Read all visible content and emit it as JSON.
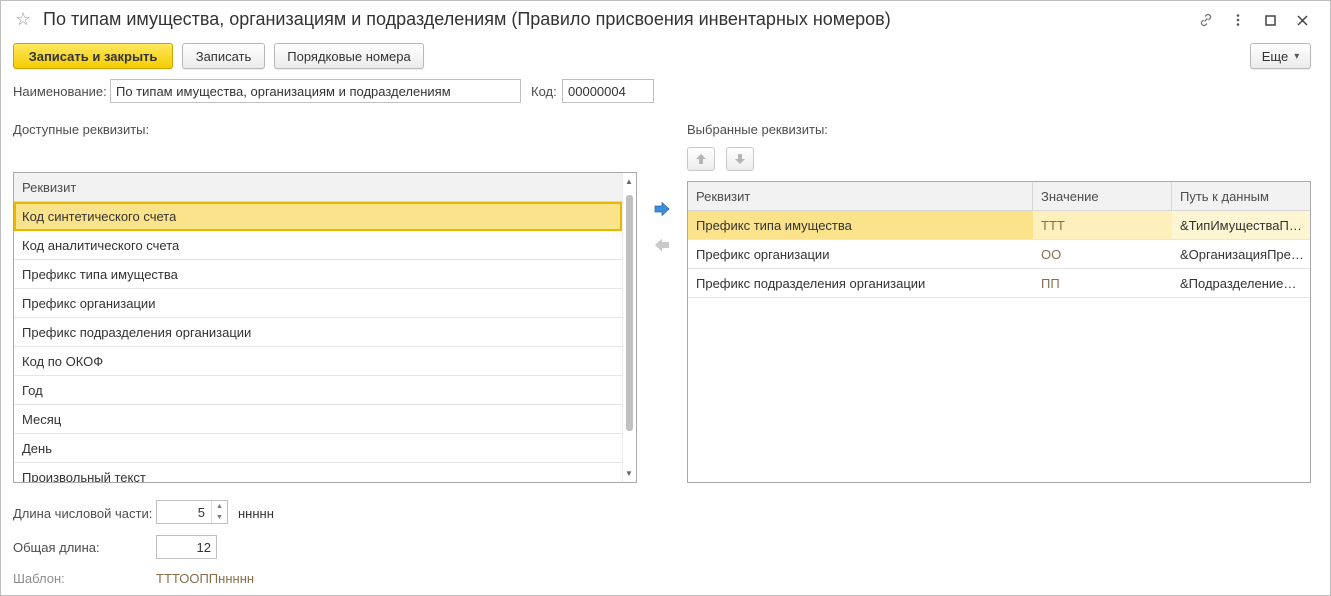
{
  "window": {
    "title": "По типам имущества, организациям и подразделениям (Правило присвоения инвентарных номеров)",
    "icons": [
      "star-icon",
      "link-icon",
      "more-vertical-icon",
      "maximize-icon",
      "close-icon"
    ]
  },
  "toolbar": {
    "save_close": "Записать и закрыть",
    "save": "Записать",
    "ordinal_numbers": "Порядковые номера",
    "more": "Еще",
    "more_arrow": "▾"
  },
  "fields": {
    "name_label": "Наименование:",
    "name_value": "По типам имущества, организациям и подразделениям",
    "code_label": "Код:",
    "code_value": "00000004"
  },
  "available": {
    "caption": "Доступные реквизиты:",
    "header": "Реквизит",
    "rows": [
      "Код синтетического счета",
      "Код аналитического счета",
      "Префикс типа имущества",
      "Префикс организации",
      "Префикс подразделения организации",
      "Код по ОКОФ",
      "Год",
      "Месяц",
      "День",
      "Произвольный текст"
    ],
    "selected_index": 0
  },
  "selected": {
    "caption": "Выбранные реквизиты:",
    "headers": [
      "Реквизит",
      "Значение",
      "Путь к данным"
    ],
    "rows": [
      {
        "attr": "Префикс типа имущества",
        "value": "ТТТ",
        "path": "&ТипИмуществаП…"
      },
      {
        "attr": "Префикс организации",
        "value": "ОО",
        "path": "&ОрганизацияПре…"
      },
      {
        "attr": "Префикс подразделения организации",
        "value": "ПП",
        "path": "&Подразделение…"
      }
    ]
  },
  "bottom": {
    "numeric_length_label": "Длина числовой части:",
    "numeric_length_value": "5",
    "numeric_mask": "ннннн",
    "total_length_label": "Общая длина:",
    "total_length_value": "12",
    "template_label": "Шаблон:",
    "template_value": "ТТТООППннннн"
  },
  "colors": {
    "primary_button": "#f5cc00",
    "selection": "#fbe38b",
    "value_text": "#8a6e4b"
  }
}
